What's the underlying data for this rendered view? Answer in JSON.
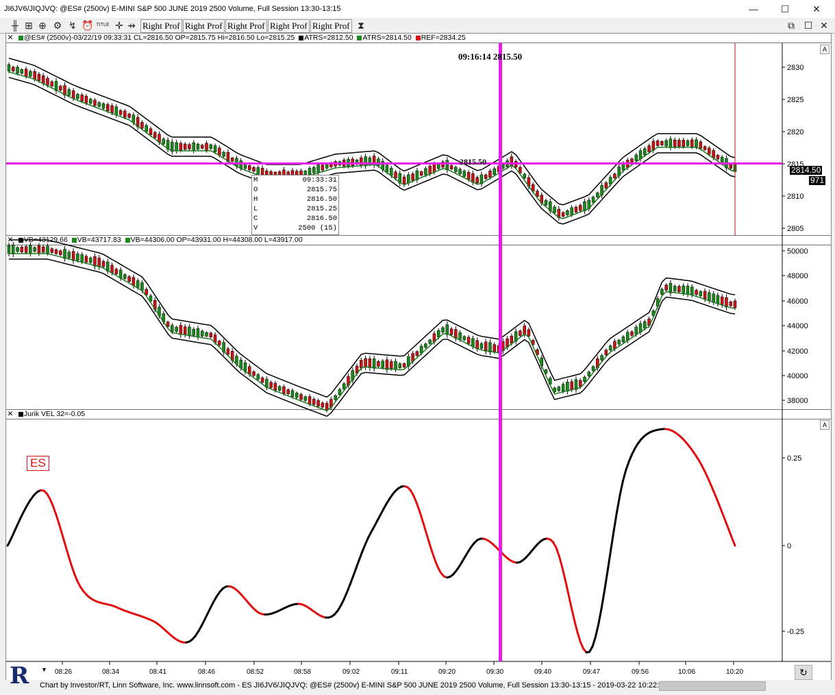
{
  "window": {
    "title": "JI6JV6/JIQJVQ: @ES# (2500v) E-MINI S&P 500 JUNE 2019 2500 Volume, Full Session 13:30-13:15",
    "minimize": "—",
    "maximize": "☐",
    "close": "✕",
    "restore": "⧉",
    "inner_close": "✕"
  },
  "toolbar": {
    "icons": [
      "bars-icon",
      "candles-icon",
      "zoom-icon",
      "gear-icon",
      "marker-icon",
      "clock-icon",
      "title-icon",
      "crosshair-icon"
    ],
    "title_icon_text": "TITLE",
    "right_prof_buttons": [
      "Right Prof",
      "Right Prof",
      "Right Prof",
      "Right Prof",
      "Right Prof"
    ],
    "hourglass": "⧗"
  },
  "pane1": {
    "header": {
      "symbol": "@ES# (2500v)-03/22/19 09:33:31 CL=2816.50 OP=2815.75 Hi=2816.50 Lo=2815.25",
      "atrs1": "ATRS=2812.50",
      "atrs2": "ATRS=2814.50",
      "ref": "REF=2834.25",
      "colors": {
        "atrs1": "#000000",
        "atrs2": "#1a8a1a",
        "ref": "#e01010"
      }
    },
    "cursor_label": "09:16:14  2815.50",
    "line_label": "2815.50",
    "price_box": "2814.50",
    "volume_box": "971",
    "scale_button": "A",
    "y_ticks": [
      "2830",
      "2825",
      "2820",
      "2815",
      "2810",
      "2805"
    ],
    "data_window": {
      "rows": [
        {
          "k": "M",
          "v": "09:33:31"
        },
        {
          "k": "O",
          "v": "2815.75"
        },
        {
          "k": "H",
          "v": "2816.50"
        },
        {
          "k": "L",
          "v": "2815.25"
        },
        {
          "k": "C",
          "v": "2816.50"
        },
        {
          "k": "V",
          "v": "2500  (15)"
        }
      ]
    }
  },
  "pane2": {
    "header": {
      "vb1": "VB=43129.66",
      "vb2": "VB=43717.83",
      "vb3": "VB=44306.00 OP=43931.00 H=44308.00 L=43917.00"
    },
    "y_ticks": [
      "50000",
      "48000",
      "46000",
      "44000",
      "42000",
      "40000",
      "38000"
    ]
  },
  "pane3": {
    "header": {
      "text": "Jurik VEL 32=-0.05"
    },
    "es_label": "ES",
    "scale_button": "A",
    "y_ticks": [
      "0.25",
      "0",
      "-0.25"
    ]
  },
  "x_axis": {
    "labels": [
      "08:26",
      "08:34",
      "08:41",
      "08:46",
      "08:52",
      "08:58",
      "09:02",
      "09:11",
      "09:20",
      "09:30",
      "09:40",
      "09:47",
      "09:56",
      "10:06",
      "10:20"
    ]
  },
  "footer": {
    "logo": "R",
    "text": "Chart by Investor/RT, Linn Software, Inc. www.linnsoft.com - ES JI6JV6/JIQJVQ: @ES# (2500v) E-MINI S&P 500 JUNE 2019 2500 Volume, Full Session 13:30-13:15 - 2019-03-22 10:22:36",
    "refresh_icon": "↻"
  },
  "colors": {
    "magenta": "#e81ce8",
    "up_candle": "#1a8a1a",
    "down_candle": "#c81414",
    "band_outer": "#000000",
    "band_inner": "#1a7a1a",
    "jurik_up": "#000000",
    "jurik_down": "#e01010",
    "ref_line": "#c01010"
  },
  "chart_data": [
    {
      "type": "line",
      "title": "Jurik VEL 32",
      "x": [
        "08:26",
        "08:34",
        "08:41",
        "08:46",
        "08:52",
        "08:58",
        "09:02",
        "09:11",
        "09:20",
        "09:30",
        "09:40",
        "09:47",
        "09:56",
        "10:06",
        "10:20"
      ],
      "ylim": [
        -0.3,
        0.32
      ],
      "series": [
        {
          "name": "Jurik VEL 32",
          "values": [
            0.0,
            0.16,
            -0.12,
            -0.18,
            -0.22,
            -0.28,
            -0.12,
            -0.2,
            -0.17,
            -0.2,
            0.04,
            0.17,
            -0.09,
            0.02,
            -0.05,
            0.01,
            -0.31,
            0.22,
            0.34,
            0.25,
            0.0
          ]
        }
      ]
    }
  ]
}
